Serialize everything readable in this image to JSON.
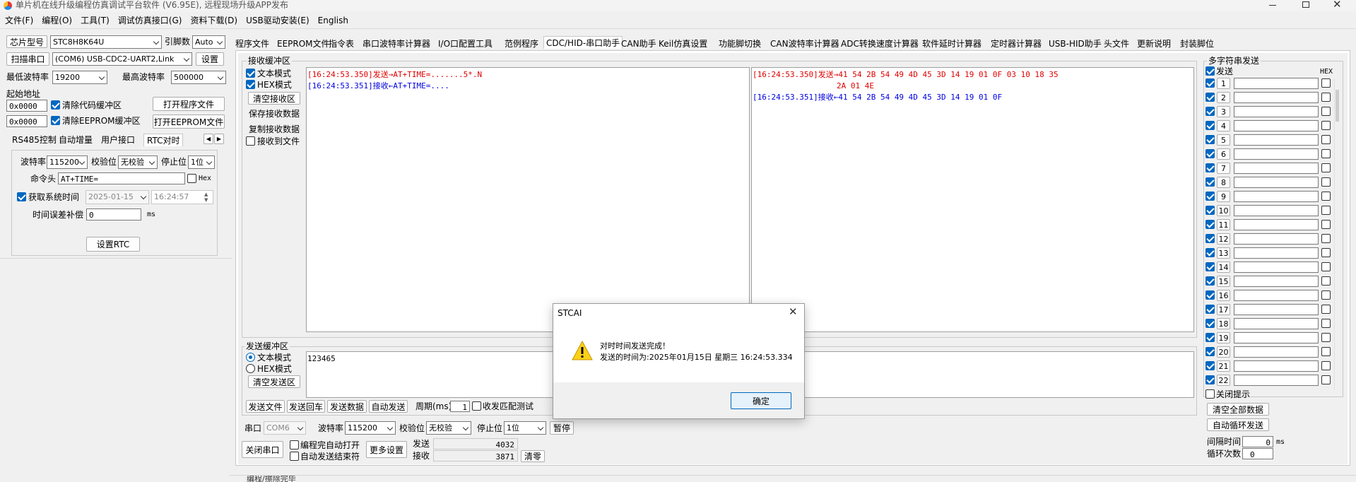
{
  "window": {
    "title": "单片机在线升级编程仿真调试平台软件 (V6.95E), 远程现场升级APP发布"
  },
  "menu": [
    "文件(F)",
    "编程(O)",
    "工具(T)",
    "调试仿真接口(G)",
    "资料下载(D)",
    "USB驱动安装(E)",
    "English"
  ],
  "left": {
    "chip_btn": "芯片型号",
    "chip": "STC8H8K64U",
    "pins_lbl": "引脚数",
    "pins": "Auto",
    "scan_btn": "扫描串口",
    "port": "(COM6) USB-CDC2-UART2,Link",
    "setup_btn": "设置",
    "minbaud_lbl": "最低波特率",
    "minbaud": "19200",
    "maxbaud_lbl": "最高波特率",
    "maxbaud": "500000",
    "start_lbl": "起始地址",
    "addr1": "0x0000",
    "addr2": "0x0000",
    "clr_code": "清除代码缓冲区",
    "clr_eeprom": "清除EEPROM缓冲区",
    "open_prog": "打开程序文件",
    "open_eeprom": "打开EEPROM文件",
    "tabs": [
      "RS485控制",
      "自动增量",
      "用户接口",
      "RTC对时"
    ],
    "rtc": {
      "baud_lbl": "波特率",
      "baud": "115200",
      "parity_lbl": "校验位",
      "parity": "无校验",
      "stop_lbl": "停止位",
      "stop": "1位",
      "cmd_lbl": "命令头",
      "cmd": "AT+TIME=",
      "hex": "Hex",
      "systime": "获取系统时间",
      "date": "2025-01-15",
      "time": "16:24:57",
      "comp_lbl": "时间误差补偿",
      "comp": "0",
      "comp_unit": "ms",
      "set_btn": "设置RTC"
    }
  },
  "tabs": [
    "程序文件",
    "EEPROM文件",
    "指令表",
    "串口波特率计算器",
    "I/O口配置工具",
    "范例程序",
    "CDC/HID-串口助手",
    "CAN助手",
    "Keil仿真设置",
    "功能脚切换",
    "CAN波特率计算器",
    "ADC转换速度计算器",
    "软件延时计算器",
    "定时器计算器",
    "USB-HID助手",
    "头文件",
    "更新说明",
    "封装脚位"
  ],
  "recv": {
    "title": "接收缓冲区",
    "text_mode": "文本模式",
    "hex_mode": "HEX模式",
    "clear": "清空接收区",
    "save": "保存接收数据",
    "copy": "复制接收数据",
    "tofile": "接收到文件",
    "t1": "[16:24:53.350]",
    "send_lbl": "发送→",
    "d1": "AT+TIME=.......5*.N",
    "t2": "[16:24:53.351]",
    "recv_lbl": "接收←",
    "d2": "AT+TIME=....",
    "h1": "41 54 2B 54 49 4D 45 3D 14 19 01 0F 03 10 18 35",
    "h1b": "2A 01 4E",
    "h2": "41 54 2B 54 49 4D 45 3D 14 19 01 0F"
  },
  "send": {
    "title": "发送缓冲区",
    "text_mode": "文本模式",
    "hex_mode": "HEX模式",
    "clear": "清空发送区",
    "content": "123465",
    "send_file": "发送文件",
    "send_echo": "发送回车",
    "send_data": "发送数据",
    "auto_send": "自动发送",
    "period_lbl": "周期(ms)",
    "period": "1",
    "match": "收发匹配测试"
  },
  "bottom": {
    "port_lbl": "串口",
    "port": "COM6",
    "baud_lbl": "波特率",
    "baud": "115200",
    "parity_lbl": "校验位",
    "parity": "无校验",
    "stop_lbl": "停止位",
    "stop": "1位",
    "pause": "暂停",
    "close": "关闭串口",
    "auto_open": "编程完自动打开",
    "auto_end": "自动发送结束符",
    "more": "更多设置",
    "sent_lbl": "发送",
    "sent": "4032",
    "recv_lbl": "接收",
    "recv": "3871",
    "clear": "清零"
  },
  "multi": {
    "title": "多字符串发送",
    "send": "发送",
    "hex": "HEX",
    "rows": [
      "1",
      "2",
      "3",
      "4",
      "5",
      "6",
      "7",
      "8",
      "9",
      "10",
      "11",
      "12",
      "13",
      "14",
      "15",
      "16",
      "17",
      "18",
      "19",
      "20",
      "21",
      "22"
    ],
    "close_hint": "关闭提示",
    "clear_all": "清空全部数据",
    "auto_loop": "自动循环发送",
    "interval_lbl": "间隔时间",
    "interval": "0",
    "interval_unit": "ms",
    "loop_lbl": "循环次数",
    "loop": "0"
  },
  "dialog": {
    "title": "STCAI",
    "line1": "对时时间发送完成！",
    "line2": "发送的时间为:2025年01月15日 星期三 16:24:53.334",
    "ok": "确定"
  },
  "statusbar": "编程/擦除完毕"
}
